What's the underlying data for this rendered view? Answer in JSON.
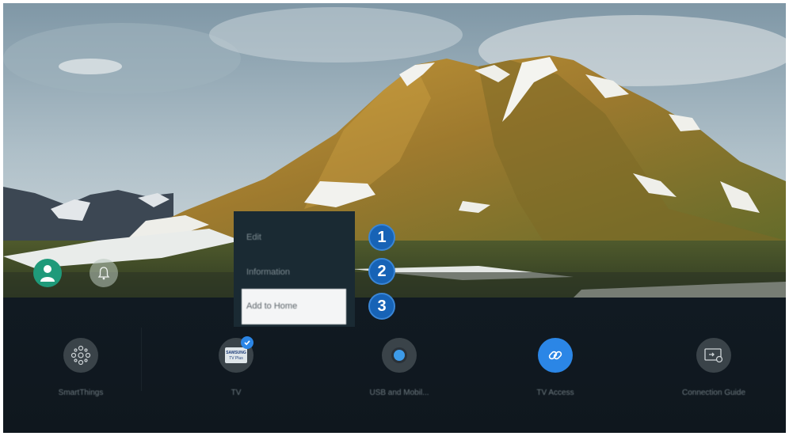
{
  "context_menu": {
    "items": [
      {
        "label": "Edit"
      },
      {
        "label": "Information"
      },
      {
        "label": "Add to Home"
      }
    ],
    "focused_index": 2
  },
  "callouts": [
    "1",
    "2",
    "3"
  ],
  "top_controls": {
    "profile_icon": "person-icon",
    "notification_icon": "bell-icon"
  },
  "apps": [
    {
      "label": "SmartThings",
      "icon": "smartthings-icon"
    },
    {
      "label": "TV",
      "icon": "samsung-tv-plus-icon",
      "badge": "check-icon",
      "logo_line1": "SAMSUNG",
      "logo_line2": "TV Plus"
    },
    {
      "label": "USB and Mobil...",
      "icon": "usb-source-icon"
    },
    {
      "label": "TV Access",
      "icon": "link-icon"
    },
    {
      "label": "Connection Guide",
      "icon": "connection-guide-icon"
    }
  ],
  "colors": {
    "callout": "#1763b6",
    "accent_blue": "#2b86e6",
    "profile": "#1f9a7a",
    "menu_bg": "#1a2a33"
  }
}
